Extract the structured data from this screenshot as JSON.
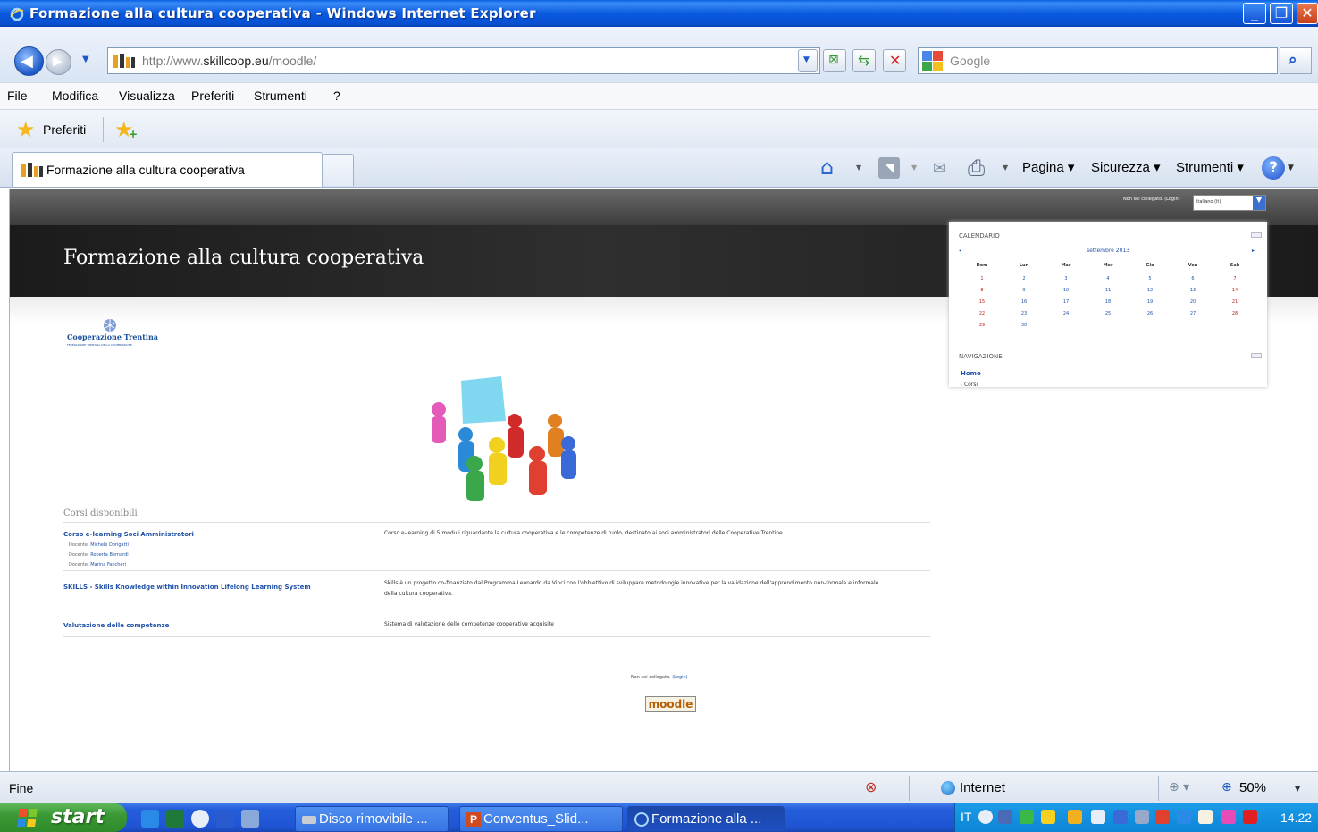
{
  "window": {
    "title": "Formazione alla cultura cooperativa - Windows Internet Explorer"
  },
  "address": {
    "url_prefix": "http://www.",
    "url_domain": "skillcoop.eu",
    "url_path": "/moodle/",
    "search_placeholder": "Google"
  },
  "menu": [
    "File",
    "Modifica",
    "Visualizza",
    "Preferiti",
    "Strumenti",
    "?"
  ],
  "favorites": {
    "label": "Preferiti"
  },
  "tab": {
    "label": "Formazione alla cultura cooperativa"
  },
  "commandbar": {
    "page": "Pagina",
    "security": "Sicurezza",
    "tools": "Strumenti"
  },
  "site": {
    "not_logged": "Non sei collegato. (Login)",
    "language": "italiano (it)",
    "title": "Formazione alla cultura cooperativa",
    "logo_name": "Cooperazione Trentina",
    "logo_sub": "FEDERAZIONE TRENTINA DELLA COOPERAZIONE"
  },
  "courses": {
    "heading": "Corsi disponibili",
    "items": [
      {
        "name": "Corso e-learning Soci Amministratori",
        "teachers": [
          {
            "role": "Docente:",
            "name": "Michele Dorigatti"
          },
          {
            "role": "Docente:",
            "name": "Roberta Bernardi"
          },
          {
            "role": "Docente:",
            "name": "Marina Fancheri"
          }
        ],
        "description": "Corso e-learning di 5 moduli riguardante la cultura cooperativa e le competenze di ruolo, destinato ai soci amministratori delle Cooperative Trentine."
      },
      {
        "name": "SKILLS - Skills Knowledge within Innovation Lifelong Learning System",
        "teachers": [],
        "description": "Skills è un progetto co-finanziato dal Programma Leonardo da Vinci con l'obbiettivo di sviluppare metodologie innovative per la validazione dell'apprendimento non-formale e informale della cultura cooperativa."
      },
      {
        "name": "Valutazione delle competenze",
        "teachers": [],
        "description": "Sistema di valutazione delle competenze cooperative acquisite"
      }
    ]
  },
  "footer": {
    "not_logged": "Non sei collegato.",
    "login": "(Login)",
    "moodle": "moodle"
  },
  "calendar": {
    "title": "CALENDARIO",
    "month": "settembre 2013",
    "days": [
      "Dom",
      "Lun",
      "Mar",
      "Mer",
      "Gio",
      "Ven",
      "Sab"
    ],
    "weeks": [
      [
        "1",
        "2",
        "3",
        "4",
        "5",
        "6",
        "7"
      ],
      [
        "8",
        "9",
        "10",
        "11",
        "12",
        "13",
        "14"
      ],
      [
        "15",
        "16",
        "17",
        "18",
        "19",
        "20",
        "21"
      ],
      [
        "22",
        "23",
        "24",
        "25",
        "26",
        "27",
        "28"
      ],
      [
        "29",
        "30",
        "",
        "",
        "",
        "",
        ""
      ]
    ]
  },
  "navigation": {
    "title": "NAVIGAZIONE",
    "home": "Home",
    "courses": "Corsi"
  },
  "statusbar": {
    "status": "Fine",
    "zone": "Internet",
    "zoom": "50%"
  },
  "taskbar": {
    "start": "start",
    "tasks": [
      "Disco rimovibile ...",
      "Conventus_Slid...",
      "Formazione alla ..."
    ],
    "lang": "IT",
    "clock": "14.22"
  }
}
